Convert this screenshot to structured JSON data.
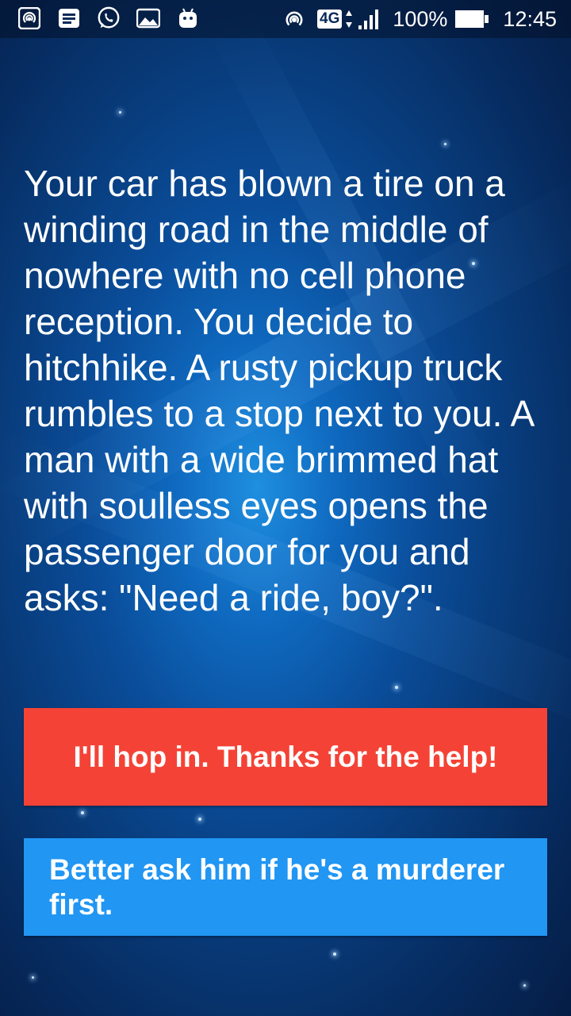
{
  "status_bar": {
    "left_icons": [
      "hotspot-icon",
      "message-icon",
      "whatsapp-icon",
      "gallery-icon",
      "android-icon"
    ],
    "network_type": "4G",
    "battery_percent": "100%",
    "time": "12:45"
  },
  "story": {
    "text": "Your car has blown a tire on a winding road in the middle of nowhere with no cell phone reception. You decide to hitchhike. A rusty pickup truck rumbles to a stop next to you. A man with a wide brimmed hat with soulless eyes opens the passenger door for you and asks: \"Need a ride, boy?\"."
  },
  "choices": [
    {
      "label": "I'll hop in. Thanks for the help!",
      "color": "#f44336"
    },
    {
      "label": "Better ask him if he's a murderer first.",
      "color": "#2196f3"
    }
  ]
}
